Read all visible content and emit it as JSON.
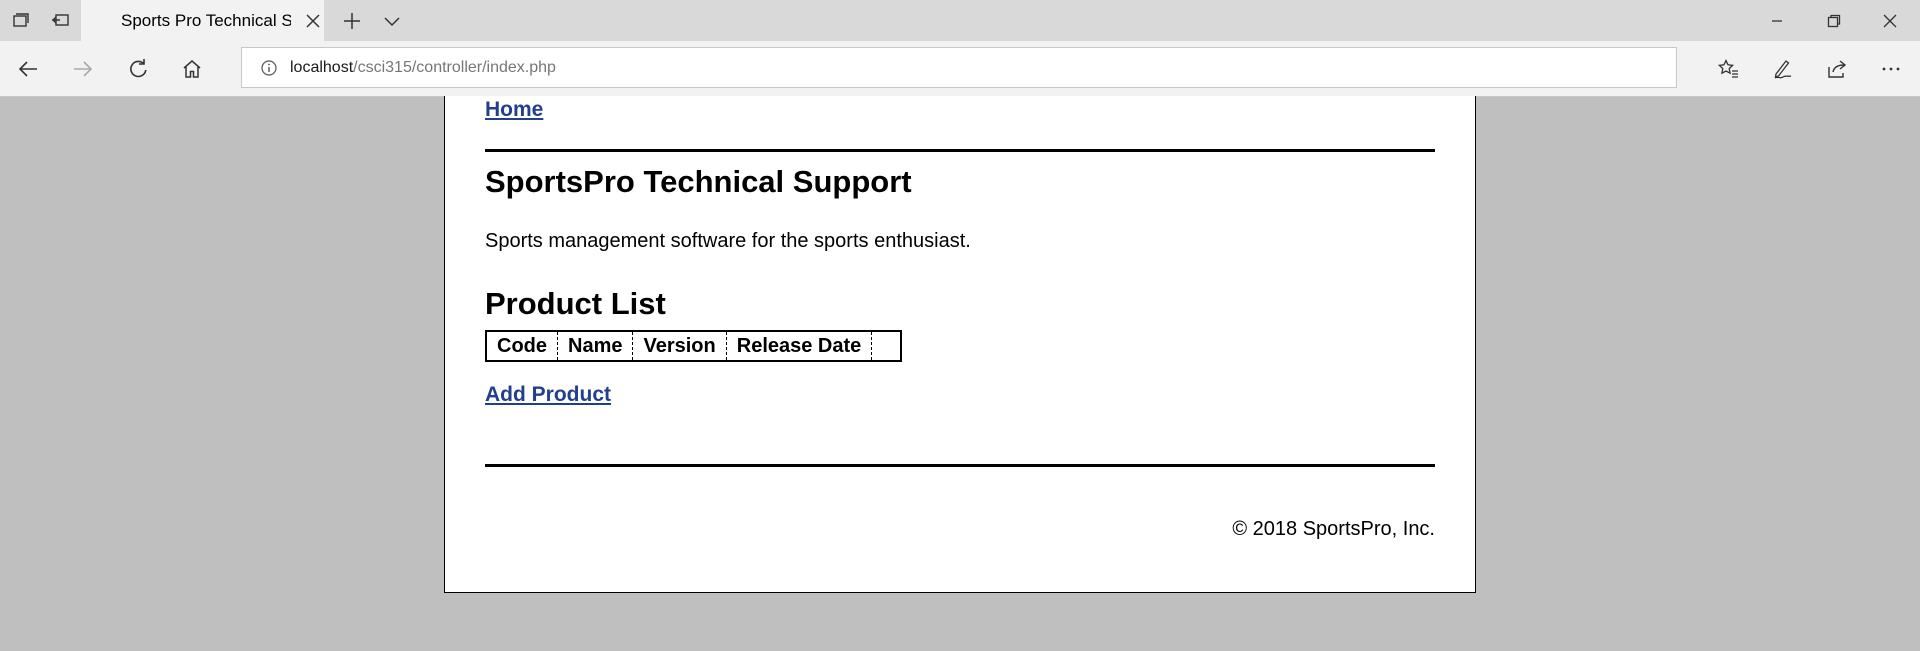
{
  "browser": {
    "tab_title": "Sports Pro Technical Support",
    "address_host": "localhost",
    "address_path": "/csci315/controller/index.php"
  },
  "page": {
    "home_link": "Home",
    "site_title": "SportsPro Technical Support",
    "tagline": "Sports management software for the sports enthusiast.",
    "list_title": "Product List",
    "table_headers": [
      "Code",
      "Name",
      "Version",
      "Release Date",
      ""
    ],
    "add_link": "Add Product",
    "copyright": "© 2018 SportsPro, Inc."
  },
  "colors": {
    "link": "#223f8f",
    "background": "#bfbfbf"
  },
  "icons": {
    "tab_actions": [
      "tabs-aside-icon",
      "tab-restore-icon"
    ],
    "nav": [
      "back-arrow-icon",
      "forward-arrow-icon",
      "refresh-icon",
      "home-icon"
    ],
    "toolbar": [
      "favorites-icon",
      "notes-pen-icon",
      "share-icon",
      "more-icon"
    ],
    "window": [
      "minimize-icon",
      "restore-icon",
      "close-icon"
    ]
  }
}
